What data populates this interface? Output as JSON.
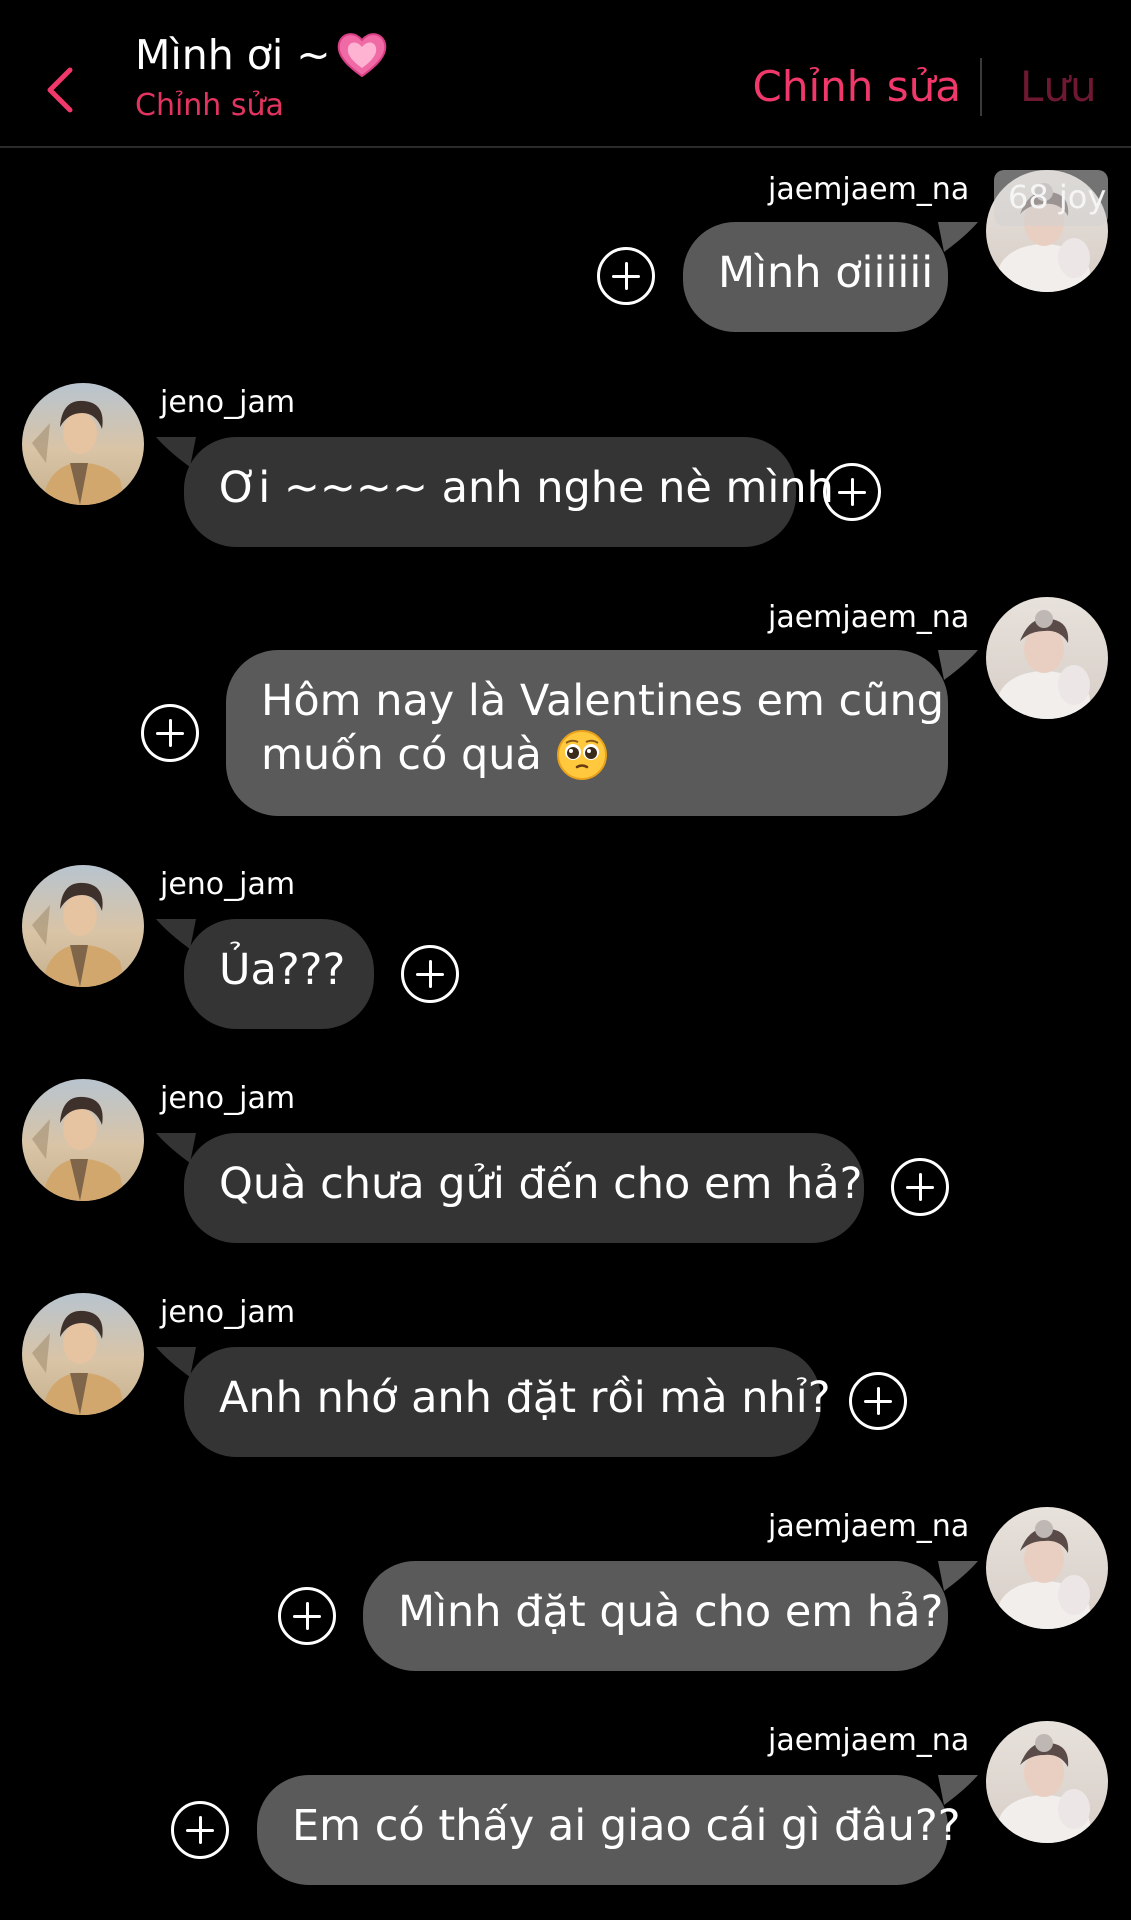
{
  "header": {
    "title": "Mình ơi ~",
    "title_emoji": "pink-heart",
    "subtitle": "Chỉnh sửa",
    "edit_label": "Chỉnh sửa",
    "save_label": "Lưu",
    "accent_color": "#f0386b"
  },
  "badge": {
    "text": "68 joy"
  },
  "users": {
    "me": "jaemjaem_na",
    "them": "jeno_jam"
  },
  "messages": [
    {
      "sender": "jaemjaem_na",
      "side": "right",
      "text": "Mình ơiiiiii"
    },
    {
      "sender": "jeno_jam",
      "side": "left",
      "text": "Ơi ~~~~ anh nghe nè mình"
    },
    {
      "sender": "jaemjaem_na",
      "side": "right",
      "line1": "Hôm nay là Valentines em cũng",
      "line2": "muốn có quà",
      "emoji": "pleading-face"
    },
    {
      "sender": "jeno_jam",
      "side": "left",
      "text": "Ủa???"
    },
    {
      "sender": "jeno_jam",
      "side": "left",
      "text": "Quà chưa gửi đến cho em hả?"
    },
    {
      "sender": "jeno_jam",
      "side": "left",
      "text": "Anh nhớ anh đặt rồi mà nhỉ?"
    },
    {
      "sender": "jaemjaem_na",
      "side": "right",
      "text": "Mình đặt quà cho em hả?"
    },
    {
      "sender": "jaemjaem_na",
      "side": "right",
      "text": "Em có thấy ai giao cái gì đâu??"
    }
  ],
  "colors": {
    "outgoing_bubble": "#5a5a5a",
    "incoming_bubble": "#343434",
    "background": "#000000"
  }
}
